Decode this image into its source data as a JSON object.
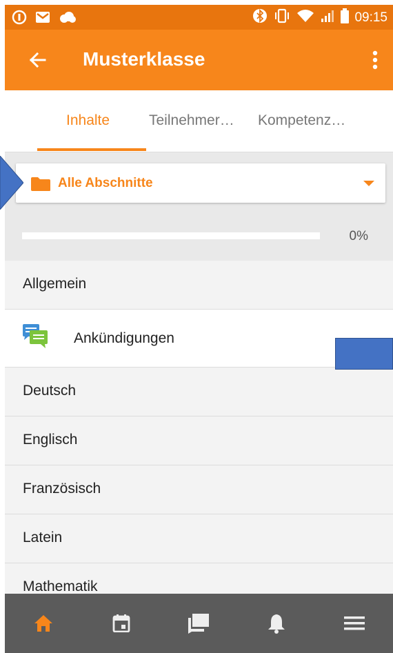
{
  "status_bar": {
    "time": "09:15",
    "left_icons": [
      "app-notification-icon",
      "gmail-icon",
      "cloud-icon"
    ],
    "right_icons": [
      "bluetooth-icon",
      "vibrate-icon",
      "wifi-icon",
      "signal-icon",
      "battery-icon"
    ]
  },
  "app_bar": {
    "title": "Musterklasse",
    "back_icon": "arrow-back-icon",
    "menu_icon": "more-vert-icon"
  },
  "tabs": [
    {
      "label": "Inhalte",
      "active": true
    },
    {
      "label": "Teilnehmer…",
      "active": false
    },
    {
      "label": "Kompetenz…",
      "active": false
    }
  ],
  "section_select": {
    "icon": "folder-icon",
    "selected": "Alle Abschnitte"
  },
  "progress": {
    "value": 0,
    "label": "0%"
  },
  "sections": {
    "allgemein": "Allgemein",
    "module": "Ankündigungen",
    "deutsch": "Deutsch",
    "englisch": "Englisch",
    "franzoesisch": "Französisch",
    "latein": "Latein",
    "mathematik": "Mathematik"
  },
  "bottom_nav": {
    "items": [
      "home-icon",
      "calendar-icon",
      "messages-icon",
      "notifications-icon",
      "menu-icon"
    ],
    "active": "home-icon"
  },
  "colors": {
    "accent": "#F7861B",
    "status_bar": "#E8750E",
    "bottom_nav": "#5b5b5b",
    "annotation": "#4472C4"
  }
}
